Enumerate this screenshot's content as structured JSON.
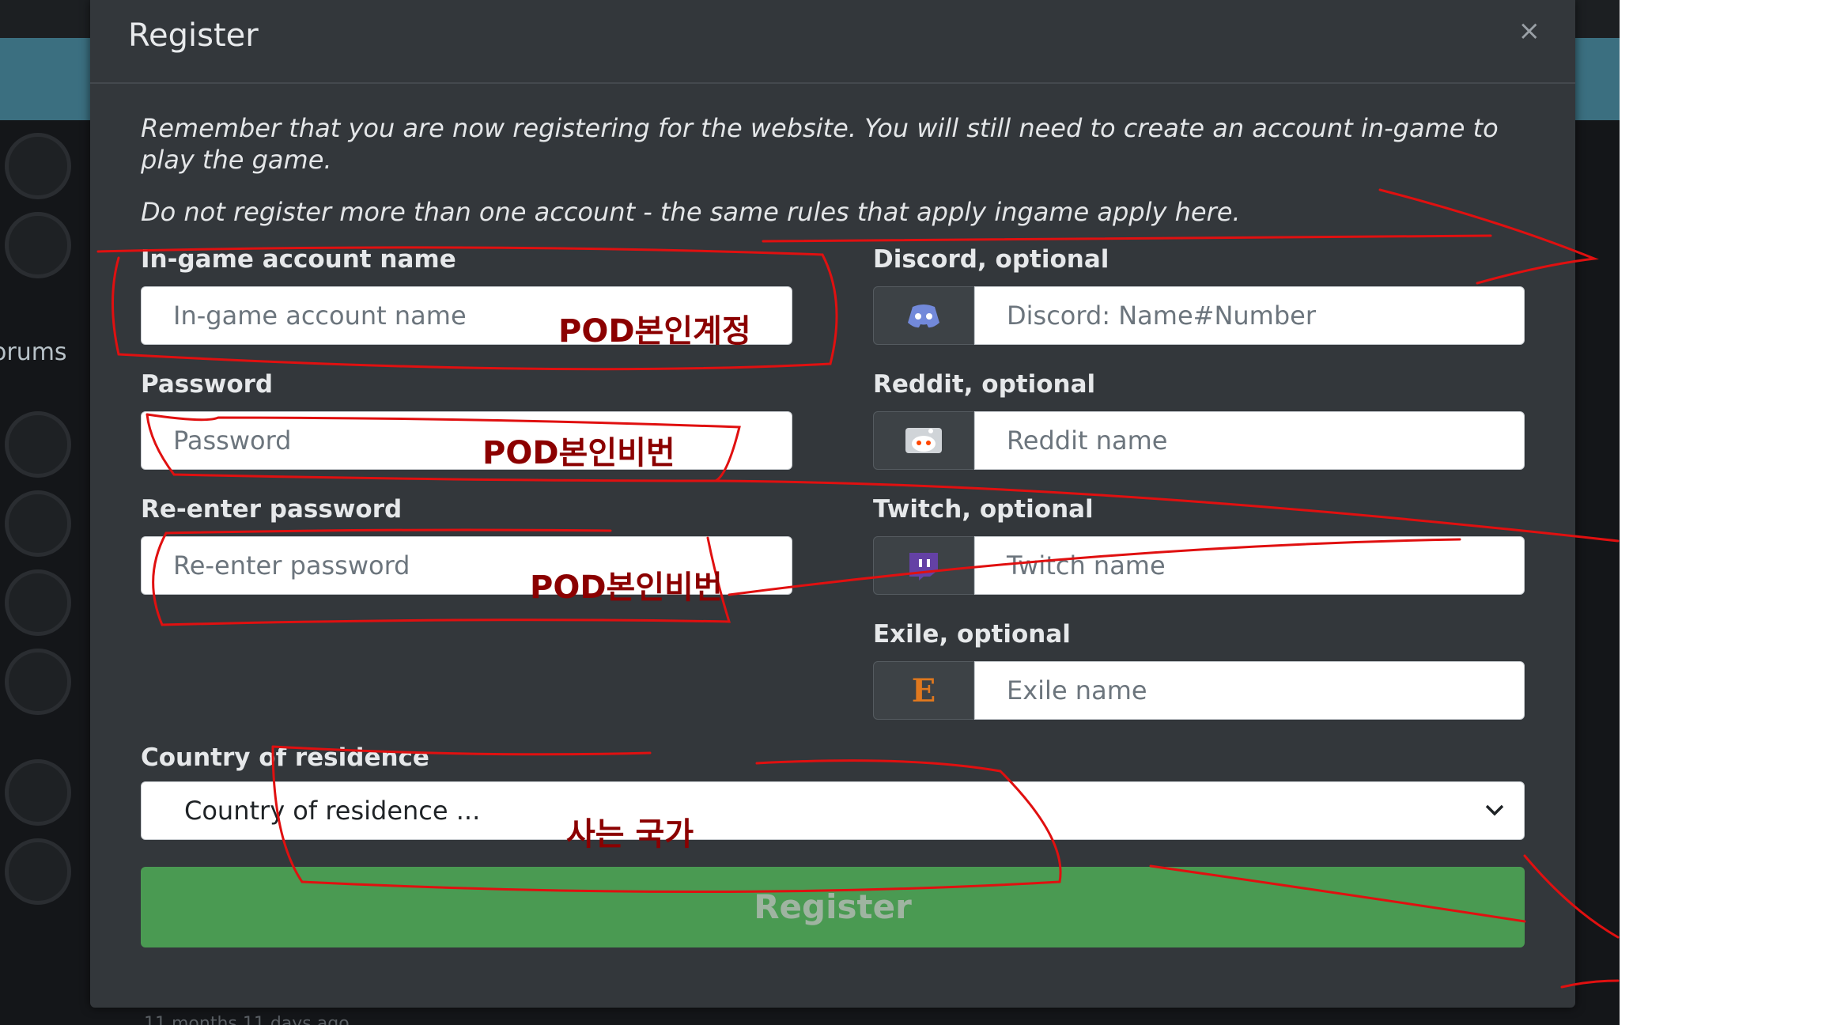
{
  "background": {
    "sidebar_link": "orums",
    "footer_text": "11 months 11 days ago"
  },
  "modal": {
    "title": "Register",
    "close_symbol": "×",
    "notice_line_1": "Remember that you are now registering for the website. You will still need to create an account in-game to play the game.",
    "notice_line_2": "Do not register more than one account - the same rules that apply ingame apply here."
  },
  "form": {
    "account_name": {
      "label": "In-game account name",
      "placeholder": "In-game account name",
      "value": ""
    },
    "password": {
      "label": "Password",
      "placeholder": "Password",
      "value": ""
    },
    "reenter_password": {
      "label": "Re-enter password",
      "placeholder": "Re-enter password",
      "value": ""
    },
    "discord": {
      "label": "Discord, optional",
      "placeholder": "Discord: Name#Number",
      "icon": "discord-icon"
    },
    "reddit": {
      "label": "Reddit, optional",
      "placeholder": "Reddit name",
      "icon": "reddit-icon"
    },
    "twitch": {
      "label": "Twitch, optional",
      "placeholder": "Twitch name",
      "icon": "twitch-icon"
    },
    "exile": {
      "label": "Exile, optional",
      "placeholder": "Exile name",
      "icon": "exile-icon",
      "icon_letter": "E"
    },
    "country": {
      "label": "Country of residence",
      "selected": "Country of residence ..."
    },
    "submit_label": "Register"
  },
  "annotations": {
    "account_note": "POD본인계정",
    "password_note": "POD본인비번",
    "reenter_note": "POD본인비번",
    "country_note": "사는 국가"
  },
  "colors": {
    "modal_bg": "#33373b",
    "register_button": "#4a9a52",
    "annotation_text": "#8b0000",
    "scribble": "#e01010",
    "discord_icon": "#7289da",
    "twitch_icon": "#6441a5",
    "exile_icon": "#e0781e"
  }
}
